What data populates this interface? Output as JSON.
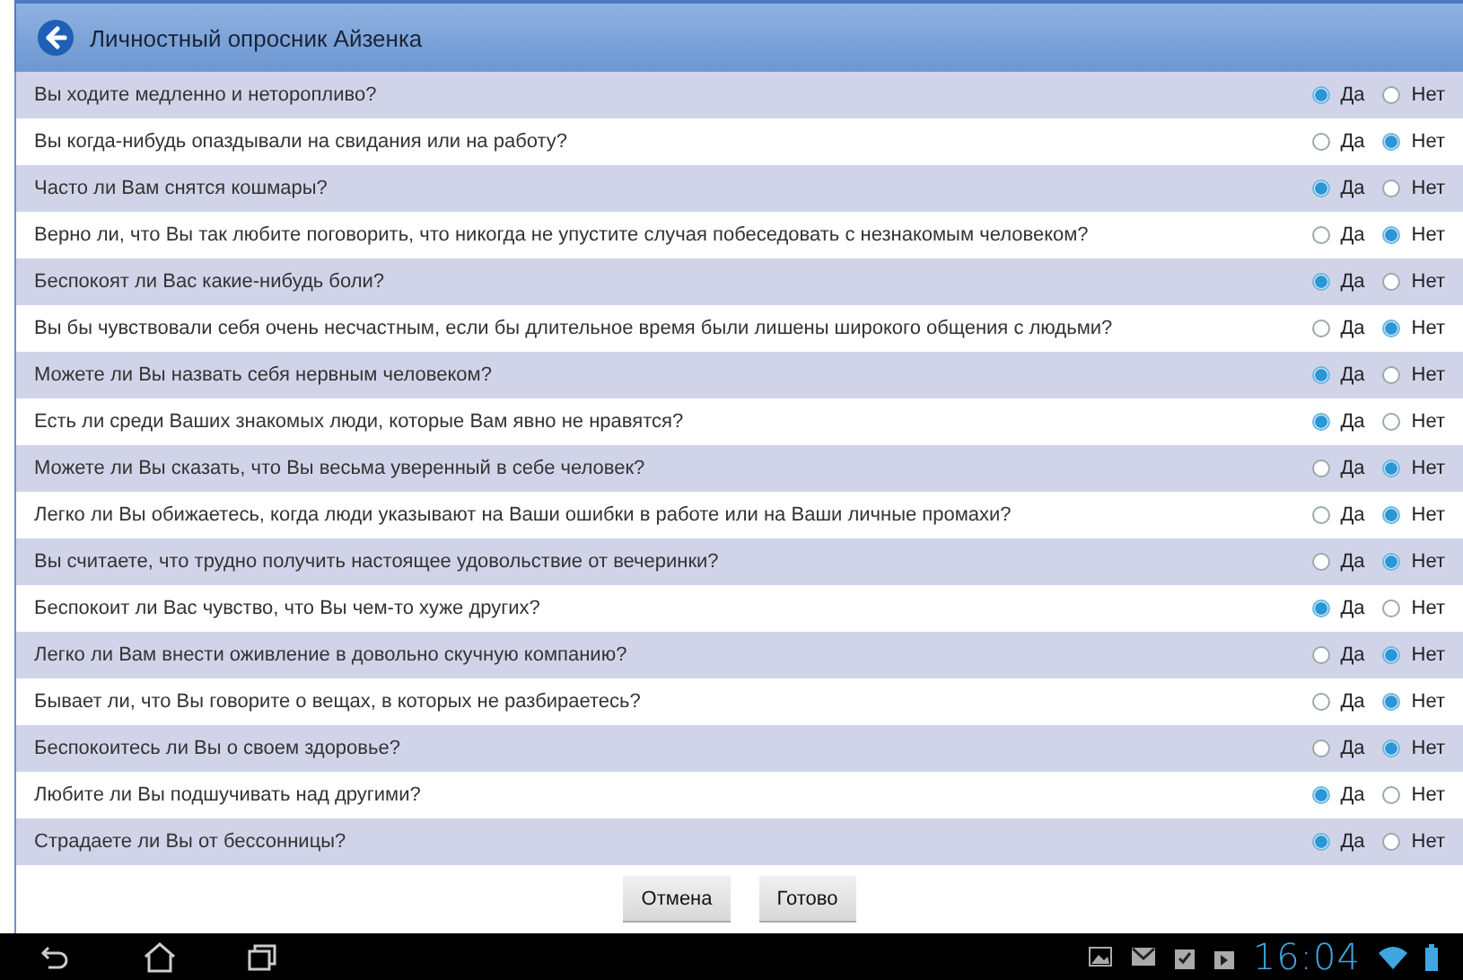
{
  "header": {
    "title": "Личностный опросник Айзенка"
  },
  "questions": [
    {
      "text": "Вы ходите медленно и неторопливо?",
      "options": [
        {
          "label": "Да",
          "selected": true
        },
        {
          "label": "Нет",
          "selected": false
        }
      ]
    },
    {
      "text": "Вы когда-нибудь опаздывали на свидания или на работу?",
      "options": [
        {
          "label": "Да",
          "selected": false
        },
        {
          "label": "Нет",
          "selected": true
        }
      ]
    },
    {
      "text": "Часто ли Вам снятся кошмары?",
      "options": [
        {
          "label": "Да",
          "selected": true
        },
        {
          "label": "Нет",
          "selected": false
        }
      ]
    },
    {
      "text": "Верно ли, что Вы так любите поговорить, что никогда не упустите случая побеседовать с незнакомым человеком?",
      "options": [
        {
          "label": "Да",
          "selected": false
        },
        {
          "label": "Нет",
          "selected": true
        }
      ]
    },
    {
      "text": "Беспокоят ли Вас какие-нибудь боли?",
      "options": [
        {
          "label": "Да",
          "selected": true
        },
        {
          "label": "Нет",
          "selected": false
        }
      ]
    },
    {
      "text": "Вы бы чувствовали себя очень несчастным, если бы длительное время были лишены широкого общения с людьми?",
      "options": [
        {
          "label": "Да",
          "selected": false
        },
        {
          "label": "Нет",
          "selected": true
        }
      ]
    },
    {
      "text": "Можете ли Вы назвать себя нервным человеком?",
      "options": [
        {
          "label": "Да",
          "selected": true
        },
        {
          "label": "Нет",
          "selected": false
        }
      ]
    },
    {
      "text": "Есть ли среди Ваших знакомых люди, которые Вам явно не нравятся?",
      "options": [
        {
          "label": "Да",
          "selected": true
        },
        {
          "label": "Нет",
          "selected": false
        }
      ]
    },
    {
      "text": "Можете ли Вы сказать, что Вы весьма уверенный в себе человек?",
      "options": [
        {
          "label": "Да",
          "selected": false
        },
        {
          "label": "Нет",
          "selected": true
        }
      ]
    },
    {
      "text": "Легко ли Вы обижаетесь, когда люди указывают на Ваши ошибки в работе или на Ваши личные промахи?",
      "options": [
        {
          "label": "Да",
          "selected": false
        },
        {
          "label": "Нет",
          "selected": true
        }
      ]
    },
    {
      "text": "Вы считаете, что трудно получить настоящее удовольствие от вечеринки?",
      "options": [
        {
          "label": "Да",
          "selected": false
        },
        {
          "label": "Нет",
          "selected": true
        }
      ]
    },
    {
      "text": "Беспокоит ли Вас чувство, что Вы чем-то хуже других?",
      "options": [
        {
          "label": "Да",
          "selected": true
        },
        {
          "label": "Нет",
          "selected": false
        }
      ]
    },
    {
      "text": "Легко ли Вам внести оживление в довольно скучную компанию?",
      "options": [
        {
          "label": "Да",
          "selected": false
        },
        {
          "label": "Нет",
          "selected": true
        }
      ]
    },
    {
      "text": "Бывает ли, что Вы говорите о вещах, в которых не разбираетесь?",
      "options": [
        {
          "label": "Да",
          "selected": false
        },
        {
          "label": "Нет",
          "selected": true
        }
      ]
    },
    {
      "text": "Беспокоитесь ли Вы о своем здоровье?",
      "options": [
        {
          "label": "Да",
          "selected": false
        },
        {
          "label": "Нет",
          "selected": true
        }
      ]
    },
    {
      "text": "Любите ли Вы подшучивать над другими?",
      "options": [
        {
          "label": "Да",
          "selected": true
        },
        {
          "label": "Нет",
          "selected": false
        }
      ]
    },
    {
      "text": "Страдаете ли Вы от бессонницы?",
      "options": [
        {
          "label": "Да",
          "selected": true
        },
        {
          "label": "Нет",
          "selected": false
        }
      ]
    }
  ],
  "buttons": [
    {
      "label": "Отмена"
    },
    {
      "label": "Готово"
    }
  ],
  "status_bar": {
    "time": "16:04"
  }
}
